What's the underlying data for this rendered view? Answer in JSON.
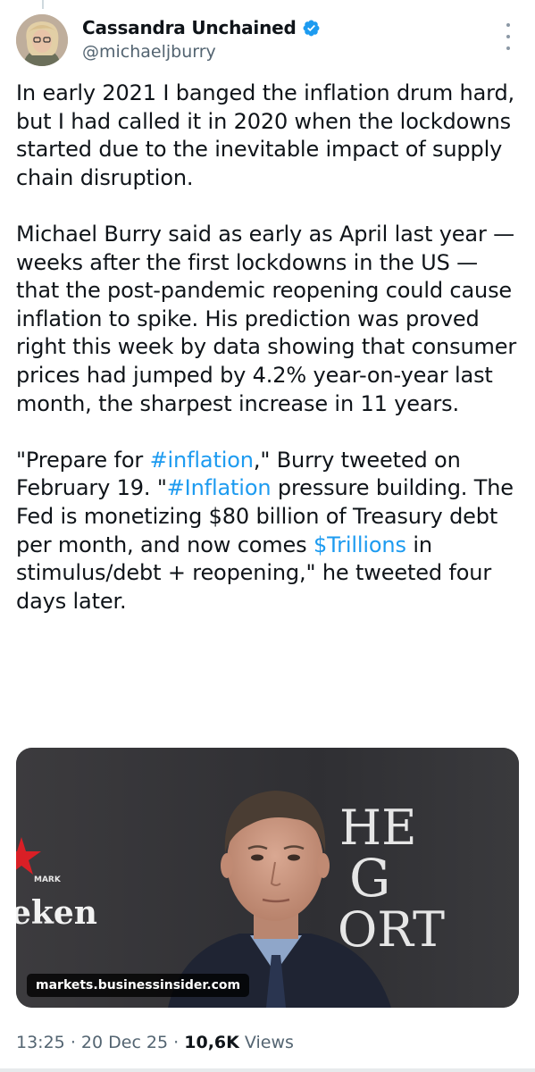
{
  "author": {
    "display_name": "Cassandra Unchained",
    "handle": "@michaeljburry",
    "verified": true,
    "verified_icon": "verified-badge-icon",
    "avatar_icon": "avatar"
  },
  "tweet": {
    "para1": "In early 2021 I banged the inflation drum hard, but I had called it in 2020 when the lockdowns started due to the inevitable impact of supply chain disruption.",
    "para2": "Michael Burry said as early as April last year — weeks after the first lockdowns in the US — that the post-pandemic reopening could cause inflation to spike. His prediction was proved right this week by data showing that consumer prices had jumped by 4.2% year-on-year last month, the sharpest increase in 11 years.",
    "para3_a": "\"Prepare for ",
    "para3_tag1": "#inflation",
    "para3_b": ",\" Burry tweeted on February 19. \"",
    "para3_tag2": "#Inflation",
    "para3_c": " pressure building. The Fed is monetizing $80 billion of Treasury debt per month, and now comes ",
    "para3_cashtag": "$Trillions",
    "para3_d": " in stimulus/debt + reopening,\" he tweeted four days later."
  },
  "media": {
    "source_label": "markets.businessinsider.com",
    "backdrop_text_left": "eken",
    "backdrop_text_left_small": "MARK",
    "backdrop_text_right_1": "HE",
    "backdrop_text_right_2": "G",
    "backdrop_text_right_3": "ORT"
  },
  "meta": {
    "time": "13:25",
    "separator": "·",
    "date": "20 Dec 25",
    "views_count": "10,6K",
    "views_label": "Views"
  },
  "colors": {
    "link": "#1d9bf0",
    "text": "#0f1419",
    "secondary": "#536471",
    "verified": "#1d9bf0"
  }
}
